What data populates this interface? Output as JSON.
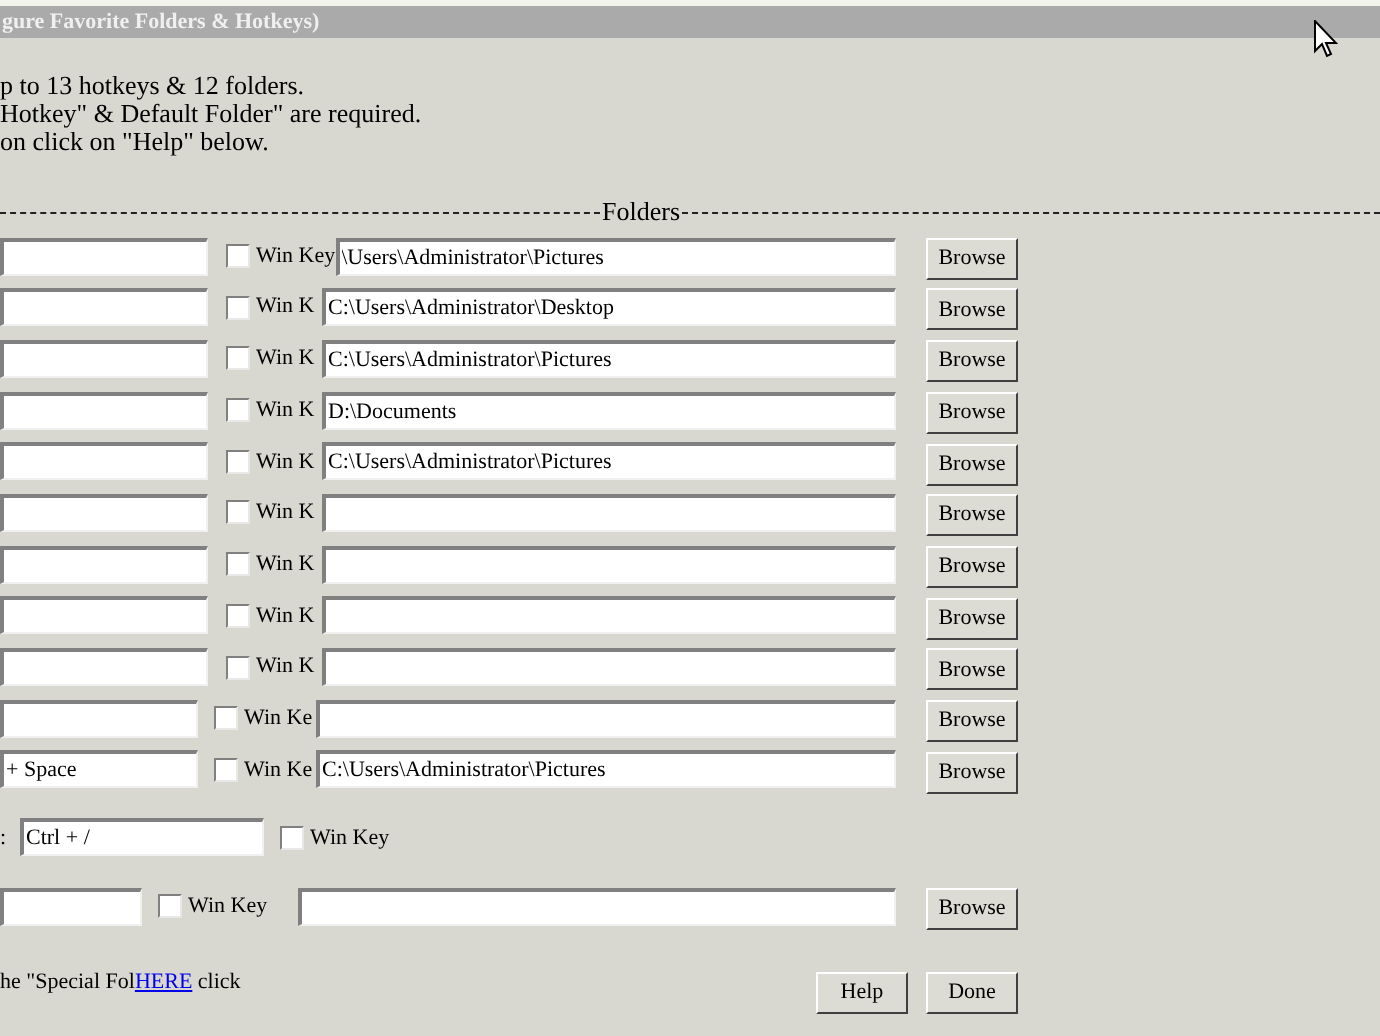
{
  "window": {
    "title": "gure Favorite Folders & Hotkeys)"
  },
  "intro": [
    "p to 13 hotkeys & 12 folders.",
    "Hotkey\" & Default Folder\" are required.",
    "on click on \"Help\" below."
  ],
  "section": {
    "label": "Folders"
  },
  "rows": [
    {
      "kind": "wide",
      "win_key": {
        "label": "Win Key",
        "checked": false
      },
      "path": "\\Users\\Administrator\\Pictures",
      "browse": "Browse"
    },
    {
      "kind": "wide",
      "win_key": {
        "label": "Win K",
        "checked": false
      },
      "path": "C:\\Users\\Administrator\\Desktop",
      "browse": "Browse"
    },
    {
      "kind": "wide",
      "win_key": {
        "label": "Win K",
        "checked": false
      },
      "path": "C:\\Users\\Administrator\\Pictures",
      "browse": "Browse"
    },
    {
      "kind": "wide",
      "win_key": {
        "label": "Win K",
        "checked": false
      },
      "path": "D:\\Documents",
      "browse": "Browse"
    },
    {
      "kind": "wide",
      "win_key": {
        "label": "Win K",
        "checked": false
      },
      "path": "C:\\Users\\Administrator\\Pictures",
      "browse": "Browse"
    },
    {
      "kind": "wide",
      "win_key": {
        "label": "Win K",
        "checked": false
      },
      "browse": "Browse"
    },
    {
      "kind": "wide",
      "win_key": {
        "label": "Win K",
        "checked": false
      },
      "browse": "Browse"
    },
    {
      "kind": "wide",
      "win_key": {
        "label": "Win K",
        "checked": false
      },
      "browse": "Browse"
    },
    {
      "kind": "wide",
      "win_key": {
        "label": "Win K",
        "checked": false
      },
      "browse": "Browse"
    },
    {
      "kind": "narrow",
      "win_key": {
        "label": "Win Ke",
        "checked": false
      },
      "browse": "Browse"
    },
    {
      "kind": "narrow",
      "hotkey": "+ Space",
      "win_key": {
        "label": "Win Ke",
        "checked": false
      },
      "path": "C:\\Users\\Administrator\\Pictures",
      "browse": "Browse"
    }
  ],
  "menu_hotkey": {
    "label": ":",
    "value": "Ctrl + /",
    "win_key": {
      "label": "Win Key",
      "checked": false
    }
  },
  "default_row": {
    "win_key": {
      "label": "Win Key",
      "checked": false
    },
    "browse": "Browse"
  },
  "footer": {
    "text": "he \"Special Fol",
    "link": "HERE",
    "after": " click"
  },
  "buttons": [
    "Help",
    "Done"
  ]
}
